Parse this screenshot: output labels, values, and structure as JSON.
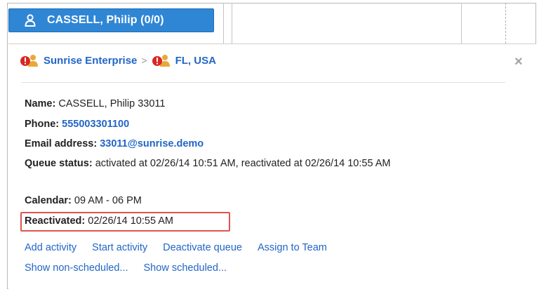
{
  "tab": {
    "label": "CASSELL, Philip (0/0)"
  },
  "breadcrumb": {
    "org": "Sunrise Enterprise",
    "location": "FL, USA",
    "separator": ">"
  },
  "close_glyph": "×",
  "details": {
    "name_label": "Name:",
    "name_value": "CASSELL, Philip 33011",
    "phone_label": "Phone:",
    "phone_value": "555003301100",
    "email_label": "Email address:",
    "email_value": "33011@sunrise.demo",
    "queue_label": "Queue status:",
    "queue_value": "activated at 02/26/14 10:51 AM, reactivated at 02/26/14 10:55 AM",
    "calendar_label": "Calendar:",
    "calendar_value": "09 AM - 06 PM",
    "reactivated_label": "Reactivated:",
    "reactivated_value": "02/26/14 10:55 AM"
  },
  "actions_row1": [
    "Add activity",
    "Start activity",
    "Deactivate queue",
    "Assign to Team"
  ],
  "actions_row2": [
    "Show non-scheduled...",
    "Show scheduled..."
  ],
  "colors": {
    "accent": "#2f86d5",
    "link": "#2266c6",
    "highlight": "#e0544f"
  }
}
